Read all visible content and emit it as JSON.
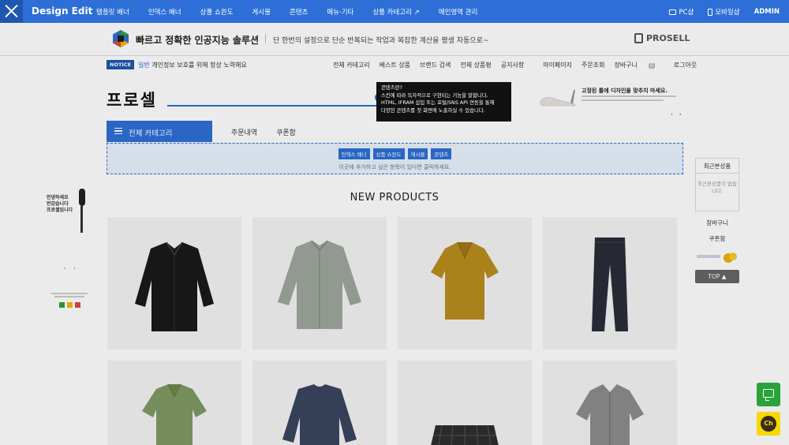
{
  "design_bar": {
    "brand": "Design Edit",
    "menu": [
      "템플릿 배너",
      "인덱스 배너",
      "상품 쇼윈도",
      "게시물",
      "콘텐츠",
      "메뉴·기타",
      "상품 카테고리 ↗",
      "메인영역 관리"
    ],
    "pc_label": "PC샵",
    "mobile_label": "모바일샵",
    "admin_label": "ADMIN"
  },
  "header": {
    "slogan": "빠르고 정확한 인공지능 솔루션",
    "description": "단 한번의 설정으로 단순 반복되는 작업과 복잡한 계산을 평생 자동으로~",
    "partner_logo": "PROSELL"
  },
  "notice": {
    "badge": "NOTICE",
    "highlight": "일반",
    "text": "개인정보 보호를 위해 항상 노력해요",
    "links": [
      "전체 카테고리",
      "베스트 상품",
      "브랜드 검색",
      "전체 상품평",
      "공지사항"
    ],
    "links_right": [
      "마이페이지",
      "주문조회",
      "장바구니",
      "로그아웃"
    ],
    "cart_count": "0"
  },
  "shop": {
    "title": "프로셀",
    "search_placeholder": ""
  },
  "promo": {
    "headline": "고정된 틀에 디자인을 맞추지 마세요."
  },
  "nav": {
    "category_button": "전체 카테고리",
    "items": [
      "주문내역",
      "쿠폰함"
    ]
  },
  "tooltip": {
    "lines": [
      "콘텐츠란?",
      "스킨에 따라 독자적으로 구현되는 기능을 말합니다.",
      "HTML, IFRAM 삽입 또는 포털/SNS API 연동을 통해",
      "다양한 콘텐츠를 첫 화면에 노출하실 수 있습니다."
    ]
  },
  "edit_zone": {
    "buttons": [
      "인덱스 배너",
      "상품 쇼윈도",
      "게시물",
      "콘텐츠"
    ],
    "hint": "이곳에 추가하고 싶은 항목이 있다면 클릭하세요."
  },
  "section": {
    "title": "NEW PRODUCTS"
  },
  "products": [
    {
      "name": "black-jacket"
    },
    {
      "name": "gray-jacket"
    },
    {
      "name": "mustard-polo"
    },
    {
      "name": "navy-pants"
    },
    {
      "name": "green-polo"
    },
    {
      "name": "navy-sweater"
    },
    {
      "name": "plaid-shorts"
    },
    {
      "name": "gray-shirt"
    }
  ],
  "left_banner": {
    "words": [
      "안녕하세요",
      "반갑습니다",
      "프로셀입니다"
    ]
  },
  "right_quick": {
    "recent_title": "최근본상품",
    "recent_empty": "최근본상품이 없습니다.",
    "cart": "장바구니",
    "coupon": "쿠폰함",
    "top": "TOP ▲"
  },
  "floating": {
    "kakao": "Ch"
  },
  "colors": {
    "accent": "#2d6fd6",
    "chat_green": "#2aa33a",
    "kakao_yellow": "#f5d900"
  }
}
